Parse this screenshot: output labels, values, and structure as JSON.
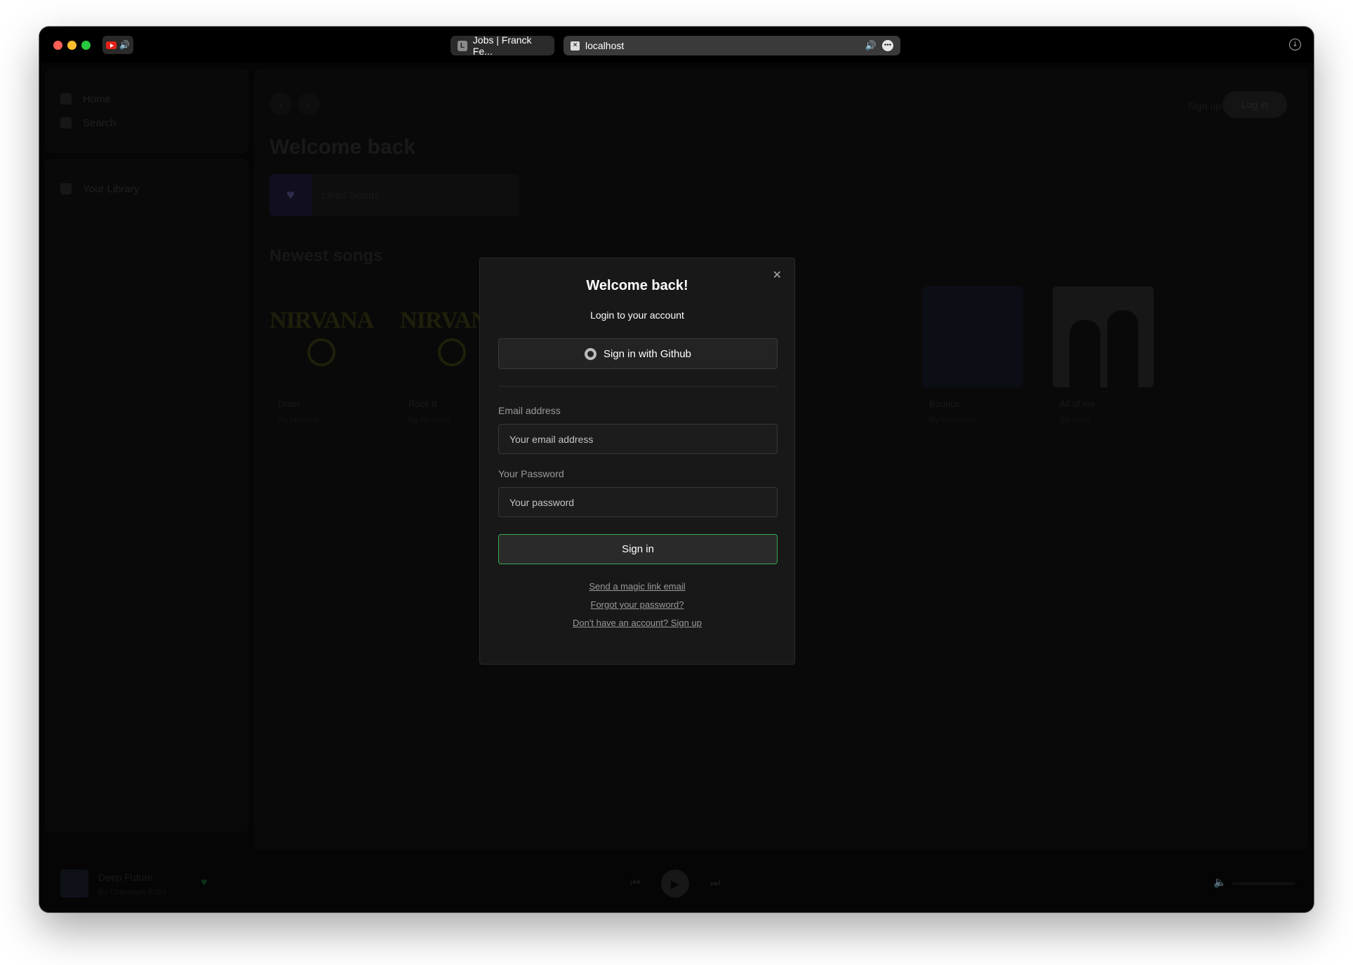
{
  "browser": {
    "tabs": [
      {
        "label": "Jobs | Franck Fe...",
        "favicon": "L"
      },
      {
        "label": "localhost"
      }
    ]
  },
  "app": {
    "sidebar": {
      "items": [
        "Home",
        "Search"
      ],
      "library_label": "Your Library"
    },
    "header": {
      "signup_label": "Sign up",
      "login_label": "Log in"
    },
    "greeting": "Welcome back",
    "liked_songs_label": "Liked Songs",
    "section_title": "Newest songs",
    "songs": [
      {
        "title": "Drain",
        "artist": "By Nirvana"
      },
      {
        "title": "Rock It",
        "artist": "By Nirvana"
      },
      {
        "title": "Bounce",
        "artist": "By Unknown"
      },
      {
        "title": "All of me",
        "artist": "By John"
      }
    ],
    "player": {
      "title": "Deep Future",
      "artist": "By Unknown Artist"
    }
  },
  "modal": {
    "title": "Welcome back!",
    "subtitle": "Login to your account",
    "github_label": "Sign in with Github",
    "email_label": "Email address",
    "email_placeholder": "Your email address",
    "password_label": "Your Password",
    "password_placeholder": "Your password",
    "signin_label": "Sign in",
    "magic_link_label": "Send a magic link email",
    "forgot_label": "Forgot your password?",
    "signup_link_label": "Don't have an account? Sign up",
    "close_symbol": "✕"
  },
  "colors": {
    "accent": "#34a853",
    "background": "#181818"
  },
  "icons": [
    "youtube-icon",
    "speaker-icon",
    "download-icon",
    "github-icon",
    "close-icon",
    "play-icon",
    "heart-icon",
    "volume-icon"
  ]
}
